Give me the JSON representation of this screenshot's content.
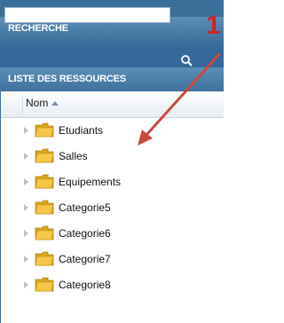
{
  "panel": {
    "search_header": "RECHERCHE",
    "search_value": "",
    "list_header": "LISTE DES RESSOURCES",
    "column_header": "Nom"
  },
  "tree_items": [
    {
      "label": "Etudiants"
    },
    {
      "label": "Salles"
    },
    {
      "label": "Equipements"
    },
    {
      "label": "Categorie5"
    },
    {
      "label": "Categorie6"
    },
    {
      "label": "Categorie7"
    },
    {
      "label": "Categorie8"
    }
  ],
  "annotation": {
    "number": "1",
    "color": "#c62828"
  },
  "colors": {
    "panel_bg": "#3a6f9a",
    "folder": "#f4c64a"
  },
  "icons": {
    "search": "search-icon",
    "folder": "folder-icon",
    "expander": "expander-triangle-icon",
    "sort": "sort-ascending-icon"
  }
}
